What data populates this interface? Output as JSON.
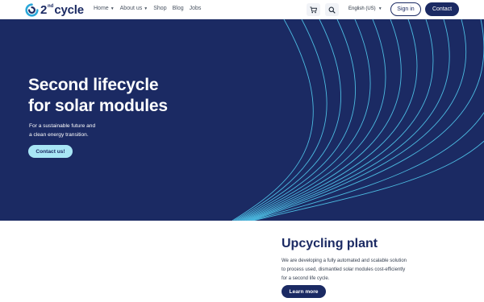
{
  "header": {
    "logo": {
      "number": "2",
      "superscript": "nd",
      "word": "cycle"
    },
    "nav": [
      {
        "label": "Home",
        "has_dropdown": true
      },
      {
        "label": "About us",
        "has_dropdown": true
      },
      {
        "label": "Shop",
        "has_dropdown": false
      },
      {
        "label": "Blog",
        "has_dropdown": false
      },
      {
        "label": "Jobs",
        "has_dropdown": false
      }
    ],
    "cart_icon": "cart-icon",
    "search_icon": "search-icon",
    "language": "English (US)",
    "signin_label": "Sign in",
    "contact_label": "Contact"
  },
  "hero": {
    "title_line1": "Second lifecycle",
    "title_line2": "for solar modules",
    "subtitle_line1": "For a sustainable future and",
    "subtitle_line2": "a clean energy transition.",
    "cta_label": "Contact us!"
  },
  "upcycling": {
    "title": "Upcycling plant",
    "text_line1": "We are developing a fully automated and scalable solution",
    "text_line2": "to process used, dismantled solar modules cost-efficiently",
    "text_line3": "for a second life cycle.",
    "button_label": "Learn more"
  },
  "colors": {
    "navy": "#1b2a63",
    "accent_light": "#a8e6f5",
    "line_cyan": "#4fc3e8"
  }
}
